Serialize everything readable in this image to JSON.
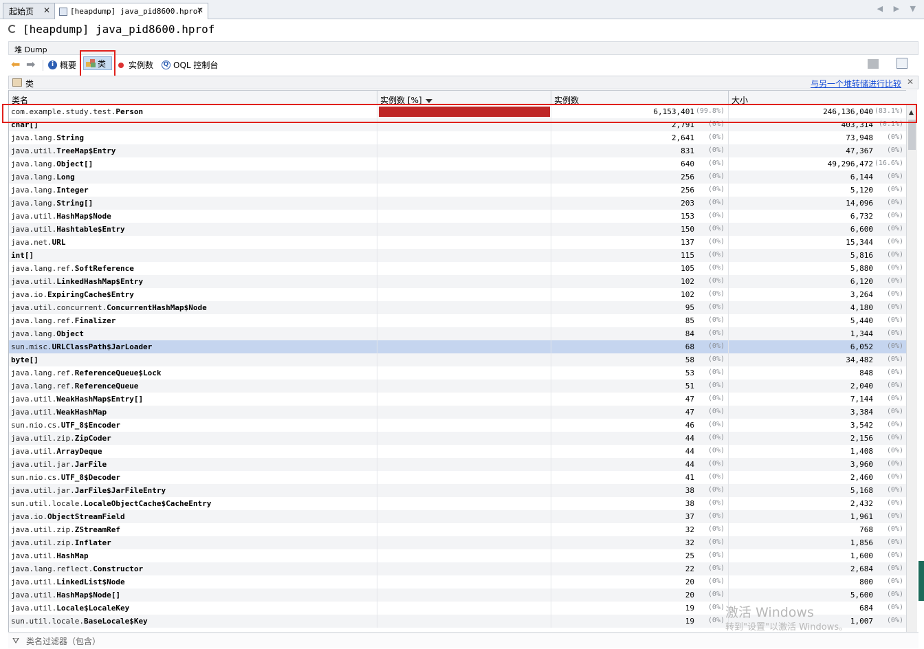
{
  "tabs": [
    {
      "label": "起始页",
      "active": false
    },
    {
      "label": "[heapdump] java_pid8600.hprof",
      "active": true
    }
  ],
  "tab_nav": "◀ ▶ ▼",
  "title": "[heapdump] java_pid8600.hprof",
  "subheader": "堆 Dump",
  "toolbar": {
    "summary": "概要",
    "classes": "类",
    "instances": "实例数",
    "oql": "OQL 控制台"
  },
  "panel": {
    "title": "类",
    "compare_link": "与另一个堆转储进行比较",
    "close": "✕"
  },
  "columns": {
    "name": "类名",
    "instances_pct": "实例数 [%]",
    "instances": "实例数",
    "size": "大小"
  },
  "rows": [
    {
      "pkg": "com.example.study.test.",
      "cls": "Person",
      "count": "6,153,401",
      "count_pct": "(99.8%)",
      "size": "246,136,040",
      "size_pct": "(83.1%)",
      "ratio": 0.998
    },
    {
      "pkg": "",
      "cls": "char[]",
      "count": "2,791",
      "count_pct": "(0%)",
      "size": "403,314",
      "size_pct": "(0.1%)",
      "ratio": 0
    },
    {
      "pkg": "java.lang.",
      "cls": "String",
      "count": "2,641",
      "count_pct": "(0%)",
      "size": "73,948",
      "size_pct": "(0%)",
      "ratio": 0
    },
    {
      "pkg": "java.util.",
      "cls": "TreeMap$Entry",
      "count": "831",
      "count_pct": "(0%)",
      "size": "47,367",
      "size_pct": "(0%)",
      "ratio": 0
    },
    {
      "pkg": "java.lang.",
      "cls": "Object[]",
      "count": "640",
      "count_pct": "(0%)",
      "size": "49,296,472",
      "size_pct": "(16.6%)",
      "ratio": 0
    },
    {
      "pkg": "java.lang.",
      "cls": "Long",
      "count": "256",
      "count_pct": "(0%)",
      "size": "6,144",
      "size_pct": "(0%)",
      "ratio": 0
    },
    {
      "pkg": "java.lang.",
      "cls": "Integer",
      "count": "256",
      "count_pct": "(0%)",
      "size": "5,120",
      "size_pct": "(0%)",
      "ratio": 0
    },
    {
      "pkg": "java.lang.",
      "cls": "String[]",
      "count": "203",
      "count_pct": "(0%)",
      "size": "14,096",
      "size_pct": "(0%)",
      "ratio": 0
    },
    {
      "pkg": "java.util.",
      "cls": "HashMap$Node",
      "count": "153",
      "count_pct": "(0%)",
      "size": "6,732",
      "size_pct": "(0%)",
      "ratio": 0
    },
    {
      "pkg": "java.util.",
      "cls": "Hashtable$Entry",
      "count": "150",
      "count_pct": "(0%)",
      "size": "6,600",
      "size_pct": "(0%)",
      "ratio": 0
    },
    {
      "pkg": "java.net.",
      "cls": "URL",
      "count": "137",
      "count_pct": "(0%)",
      "size": "15,344",
      "size_pct": "(0%)",
      "ratio": 0
    },
    {
      "pkg": "",
      "cls": "int[]",
      "count": "115",
      "count_pct": "(0%)",
      "size": "5,816",
      "size_pct": "(0%)",
      "ratio": 0
    },
    {
      "pkg": "java.lang.ref.",
      "cls": "SoftReference",
      "count": "105",
      "count_pct": "(0%)",
      "size": "5,880",
      "size_pct": "(0%)",
      "ratio": 0
    },
    {
      "pkg": "java.util.",
      "cls": "LinkedHashMap$Entry",
      "count": "102",
      "count_pct": "(0%)",
      "size": "6,120",
      "size_pct": "(0%)",
      "ratio": 0
    },
    {
      "pkg": "java.io.",
      "cls": "ExpiringCache$Entry",
      "count": "102",
      "count_pct": "(0%)",
      "size": "3,264",
      "size_pct": "(0%)",
      "ratio": 0
    },
    {
      "pkg": "java.util.concurrent.",
      "cls": "ConcurrentHashMap$Node",
      "count": "95",
      "count_pct": "(0%)",
      "size": "4,180",
      "size_pct": "(0%)",
      "ratio": 0
    },
    {
      "pkg": "java.lang.ref.",
      "cls": "Finalizer",
      "count": "85",
      "count_pct": "(0%)",
      "size": "5,440",
      "size_pct": "(0%)",
      "ratio": 0
    },
    {
      "pkg": "java.lang.",
      "cls": "Object",
      "count": "84",
      "count_pct": "(0%)",
      "size": "1,344",
      "size_pct": "(0%)",
      "ratio": 0
    },
    {
      "pkg": "sun.misc.",
      "cls": "URLClassPath$JarLoader",
      "count": "68",
      "count_pct": "(0%)",
      "size": "6,052",
      "size_pct": "(0%)",
      "ratio": 0,
      "selected": true
    },
    {
      "pkg": "",
      "cls": "byte[]",
      "count": "58",
      "count_pct": "(0%)",
      "size": "34,482",
      "size_pct": "(0%)",
      "ratio": 0
    },
    {
      "pkg": "java.lang.ref.",
      "cls": "ReferenceQueue$Lock",
      "count": "53",
      "count_pct": "(0%)",
      "size": "848",
      "size_pct": "(0%)",
      "ratio": 0
    },
    {
      "pkg": "java.lang.ref.",
      "cls": "ReferenceQueue",
      "count": "51",
      "count_pct": "(0%)",
      "size": "2,040",
      "size_pct": "(0%)",
      "ratio": 0
    },
    {
      "pkg": "java.util.",
      "cls": "WeakHashMap$Entry[]",
      "count": "47",
      "count_pct": "(0%)",
      "size": "7,144",
      "size_pct": "(0%)",
      "ratio": 0
    },
    {
      "pkg": "java.util.",
      "cls": "WeakHashMap",
      "count": "47",
      "count_pct": "(0%)",
      "size": "3,384",
      "size_pct": "(0%)",
      "ratio": 0
    },
    {
      "pkg": "sun.nio.cs.",
      "cls": "UTF_8$Encoder",
      "count": "46",
      "count_pct": "(0%)",
      "size": "3,542",
      "size_pct": "(0%)",
      "ratio": 0
    },
    {
      "pkg": "java.util.zip.",
      "cls": "ZipCoder",
      "count": "44",
      "count_pct": "(0%)",
      "size": "2,156",
      "size_pct": "(0%)",
      "ratio": 0
    },
    {
      "pkg": "java.util.",
      "cls": "ArrayDeque",
      "count": "44",
      "count_pct": "(0%)",
      "size": "1,408",
      "size_pct": "(0%)",
      "ratio": 0
    },
    {
      "pkg": "java.util.jar.",
      "cls": "JarFile",
      "count": "44",
      "count_pct": "(0%)",
      "size": "3,960",
      "size_pct": "(0%)",
      "ratio": 0
    },
    {
      "pkg": "sun.nio.cs.",
      "cls": "UTF_8$Decoder",
      "count": "41",
      "count_pct": "(0%)",
      "size": "2,460",
      "size_pct": "(0%)",
      "ratio": 0
    },
    {
      "pkg": "java.util.jar.",
      "cls": "JarFile$JarFileEntry",
      "count": "38",
      "count_pct": "(0%)",
      "size": "5,168",
      "size_pct": "(0%)",
      "ratio": 0
    },
    {
      "pkg": "sun.util.locale.",
      "cls": "LocaleObjectCache$CacheEntry",
      "count": "38",
      "count_pct": "(0%)",
      "size": "2,432",
      "size_pct": "(0%)",
      "ratio": 0
    },
    {
      "pkg": "java.io.",
      "cls": "ObjectStreamField",
      "count": "37",
      "count_pct": "(0%)",
      "size": "1,961",
      "size_pct": "(0%)",
      "ratio": 0
    },
    {
      "pkg": "java.util.zip.",
      "cls": "ZStreamRef",
      "count": "32",
      "count_pct": "(0%)",
      "size": "768",
      "size_pct": "(0%)",
      "ratio": 0
    },
    {
      "pkg": "java.util.zip.",
      "cls": "Inflater",
      "count": "32",
      "count_pct": "(0%)",
      "size": "1,856",
      "size_pct": "(0%)",
      "ratio": 0
    },
    {
      "pkg": "java.util.",
      "cls": "HashMap",
      "count": "25",
      "count_pct": "(0%)",
      "size": "1,600",
      "size_pct": "(0%)",
      "ratio": 0
    },
    {
      "pkg": "java.lang.reflect.",
      "cls": "Constructor",
      "count": "22",
      "count_pct": "(0%)",
      "size": "2,684",
      "size_pct": "(0%)",
      "ratio": 0
    },
    {
      "pkg": "java.util.",
      "cls": "LinkedList$Node",
      "count": "20",
      "count_pct": "(0%)",
      "size": "800",
      "size_pct": "(0%)",
      "ratio": 0
    },
    {
      "pkg": "java.util.",
      "cls": "HashMap$Node[]",
      "count": "20",
      "count_pct": "(0%)",
      "size": "5,600",
      "size_pct": "(0%)",
      "ratio": 0
    },
    {
      "pkg": "java.util.",
      "cls": "Locale$LocaleKey",
      "count": "19",
      "count_pct": "(0%)",
      "size": "684",
      "size_pct": "(0%)",
      "ratio": 0
    },
    {
      "pkg": "sun.util.locale.",
      "cls": "BaseLocale$Key",
      "count": "19",
      "count_pct": "(0%)",
      "size": "1,007",
      "size_pct": "(0%)",
      "ratio": 0
    }
  ],
  "filter_placeholder": "类名过滤器（包含）",
  "watermark": {
    "line1": "激活 Windows",
    "line2": "转到\"设置\"以激活 Windows。"
  },
  "colors": {
    "bar": "#bf2727",
    "highlight": "#e0201b",
    "selected_row": "#c5d5ef",
    "link": "#1a4fd6"
  }
}
